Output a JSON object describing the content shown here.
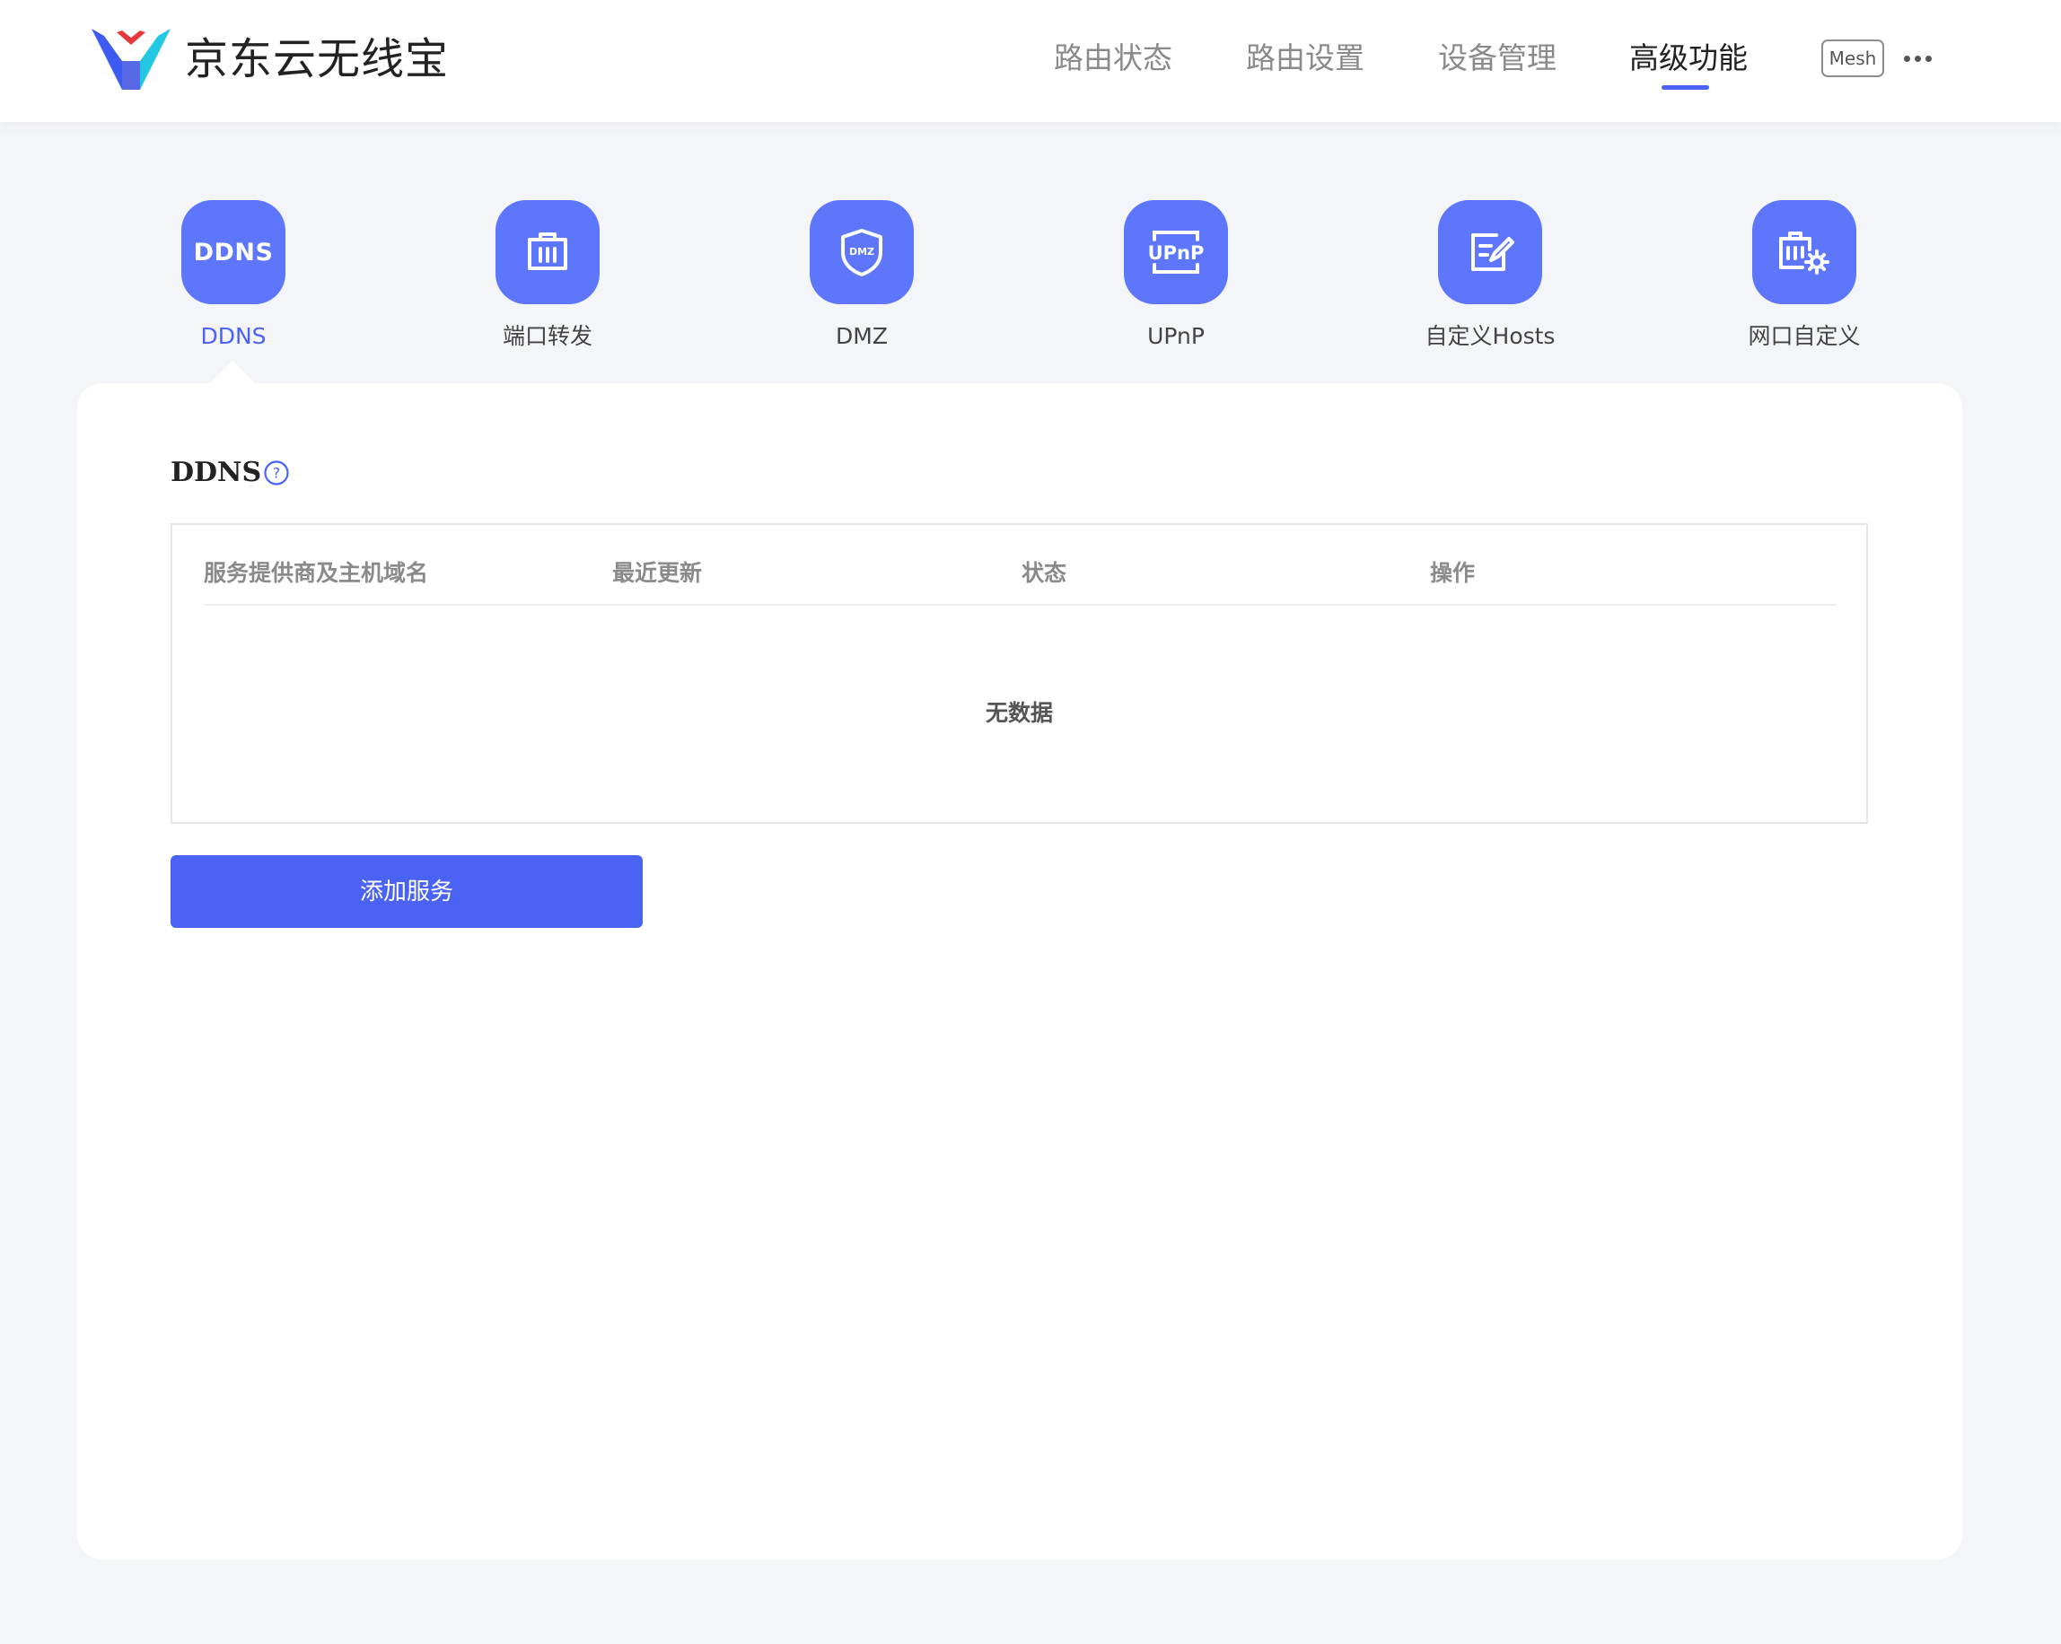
{
  "header": {
    "brand": "京东云无线宝",
    "nav": [
      {
        "label": "路由状态"
      },
      {
        "label": "路由设置"
      },
      {
        "label": "设备管理"
      },
      {
        "label": "高级功能",
        "active": true
      }
    ],
    "mesh_label": "Mesh",
    "more_icon": "ellipsis-icon"
  },
  "features": [
    {
      "label": "DDNS",
      "icon_text": "DDNS",
      "active": true
    },
    {
      "label": "端口转发",
      "icon": "port-icon"
    },
    {
      "label": "DMZ",
      "icon": "shield-icon",
      "icon_text": "DMZ"
    },
    {
      "label": "UPnP",
      "icon": "upnp-icon",
      "icon_text": "UPnP"
    },
    {
      "label": "自定义Hosts",
      "icon": "edit-icon"
    },
    {
      "label": "网口自定义",
      "icon": "port-settings-icon"
    }
  ],
  "section": {
    "title": "DDNS",
    "help_icon": "question-icon"
  },
  "table": {
    "columns": [
      "服务提供商及主机域名",
      "最近更新",
      "状态",
      "操作"
    ],
    "empty_text": "无数据"
  },
  "add_button_label": "添加服务",
  "colors": {
    "accent": "#4a63f5",
    "tile": "#5d76fb",
    "background": "#f4f5f9"
  }
}
